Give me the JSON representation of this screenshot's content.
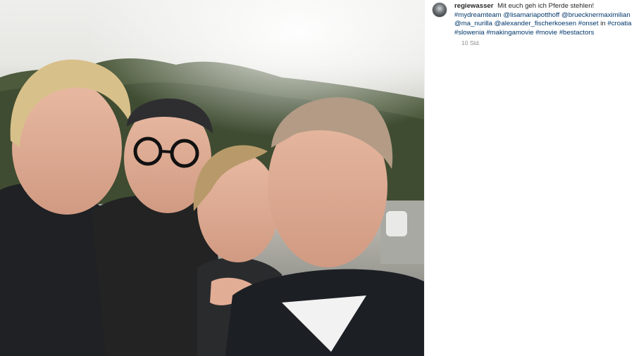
{
  "post": {
    "username": "regiewasser",
    "caption_parts": [
      {
        "text": "Mit euch geh ich Pferde stehlen!",
        "kind": "text"
      },
      {
        "text": "#mydreamteam",
        "kind": "tag"
      },
      {
        "text": "@lisamariapotthoff",
        "kind": "tag"
      },
      {
        "text": "@bruecknermaximilian",
        "kind": "tag"
      },
      {
        "text": "@ma_nurilla",
        "kind": "tag"
      },
      {
        "text": "@alexander_fischerkoesen",
        "kind": "tag"
      },
      {
        "text": "#onset",
        "kind": "tag"
      },
      {
        "text": "in",
        "kind": "text"
      },
      {
        "text": "#croatia",
        "kind": "tag"
      },
      {
        "text": "#slowenia",
        "kind": "tag"
      },
      {
        "text": "#makingamovie",
        "kind": "tag"
      },
      {
        "text": "#movie",
        "kind": "tag"
      },
      {
        "text": "#bestactors",
        "kind": "tag"
      }
    ],
    "timestamp": "10 Std."
  },
  "colors": {
    "link": "#00376b",
    "text": "#262626",
    "muted": "#8e8e8e"
  },
  "icons": {
    "avatar": "profile-avatar"
  }
}
